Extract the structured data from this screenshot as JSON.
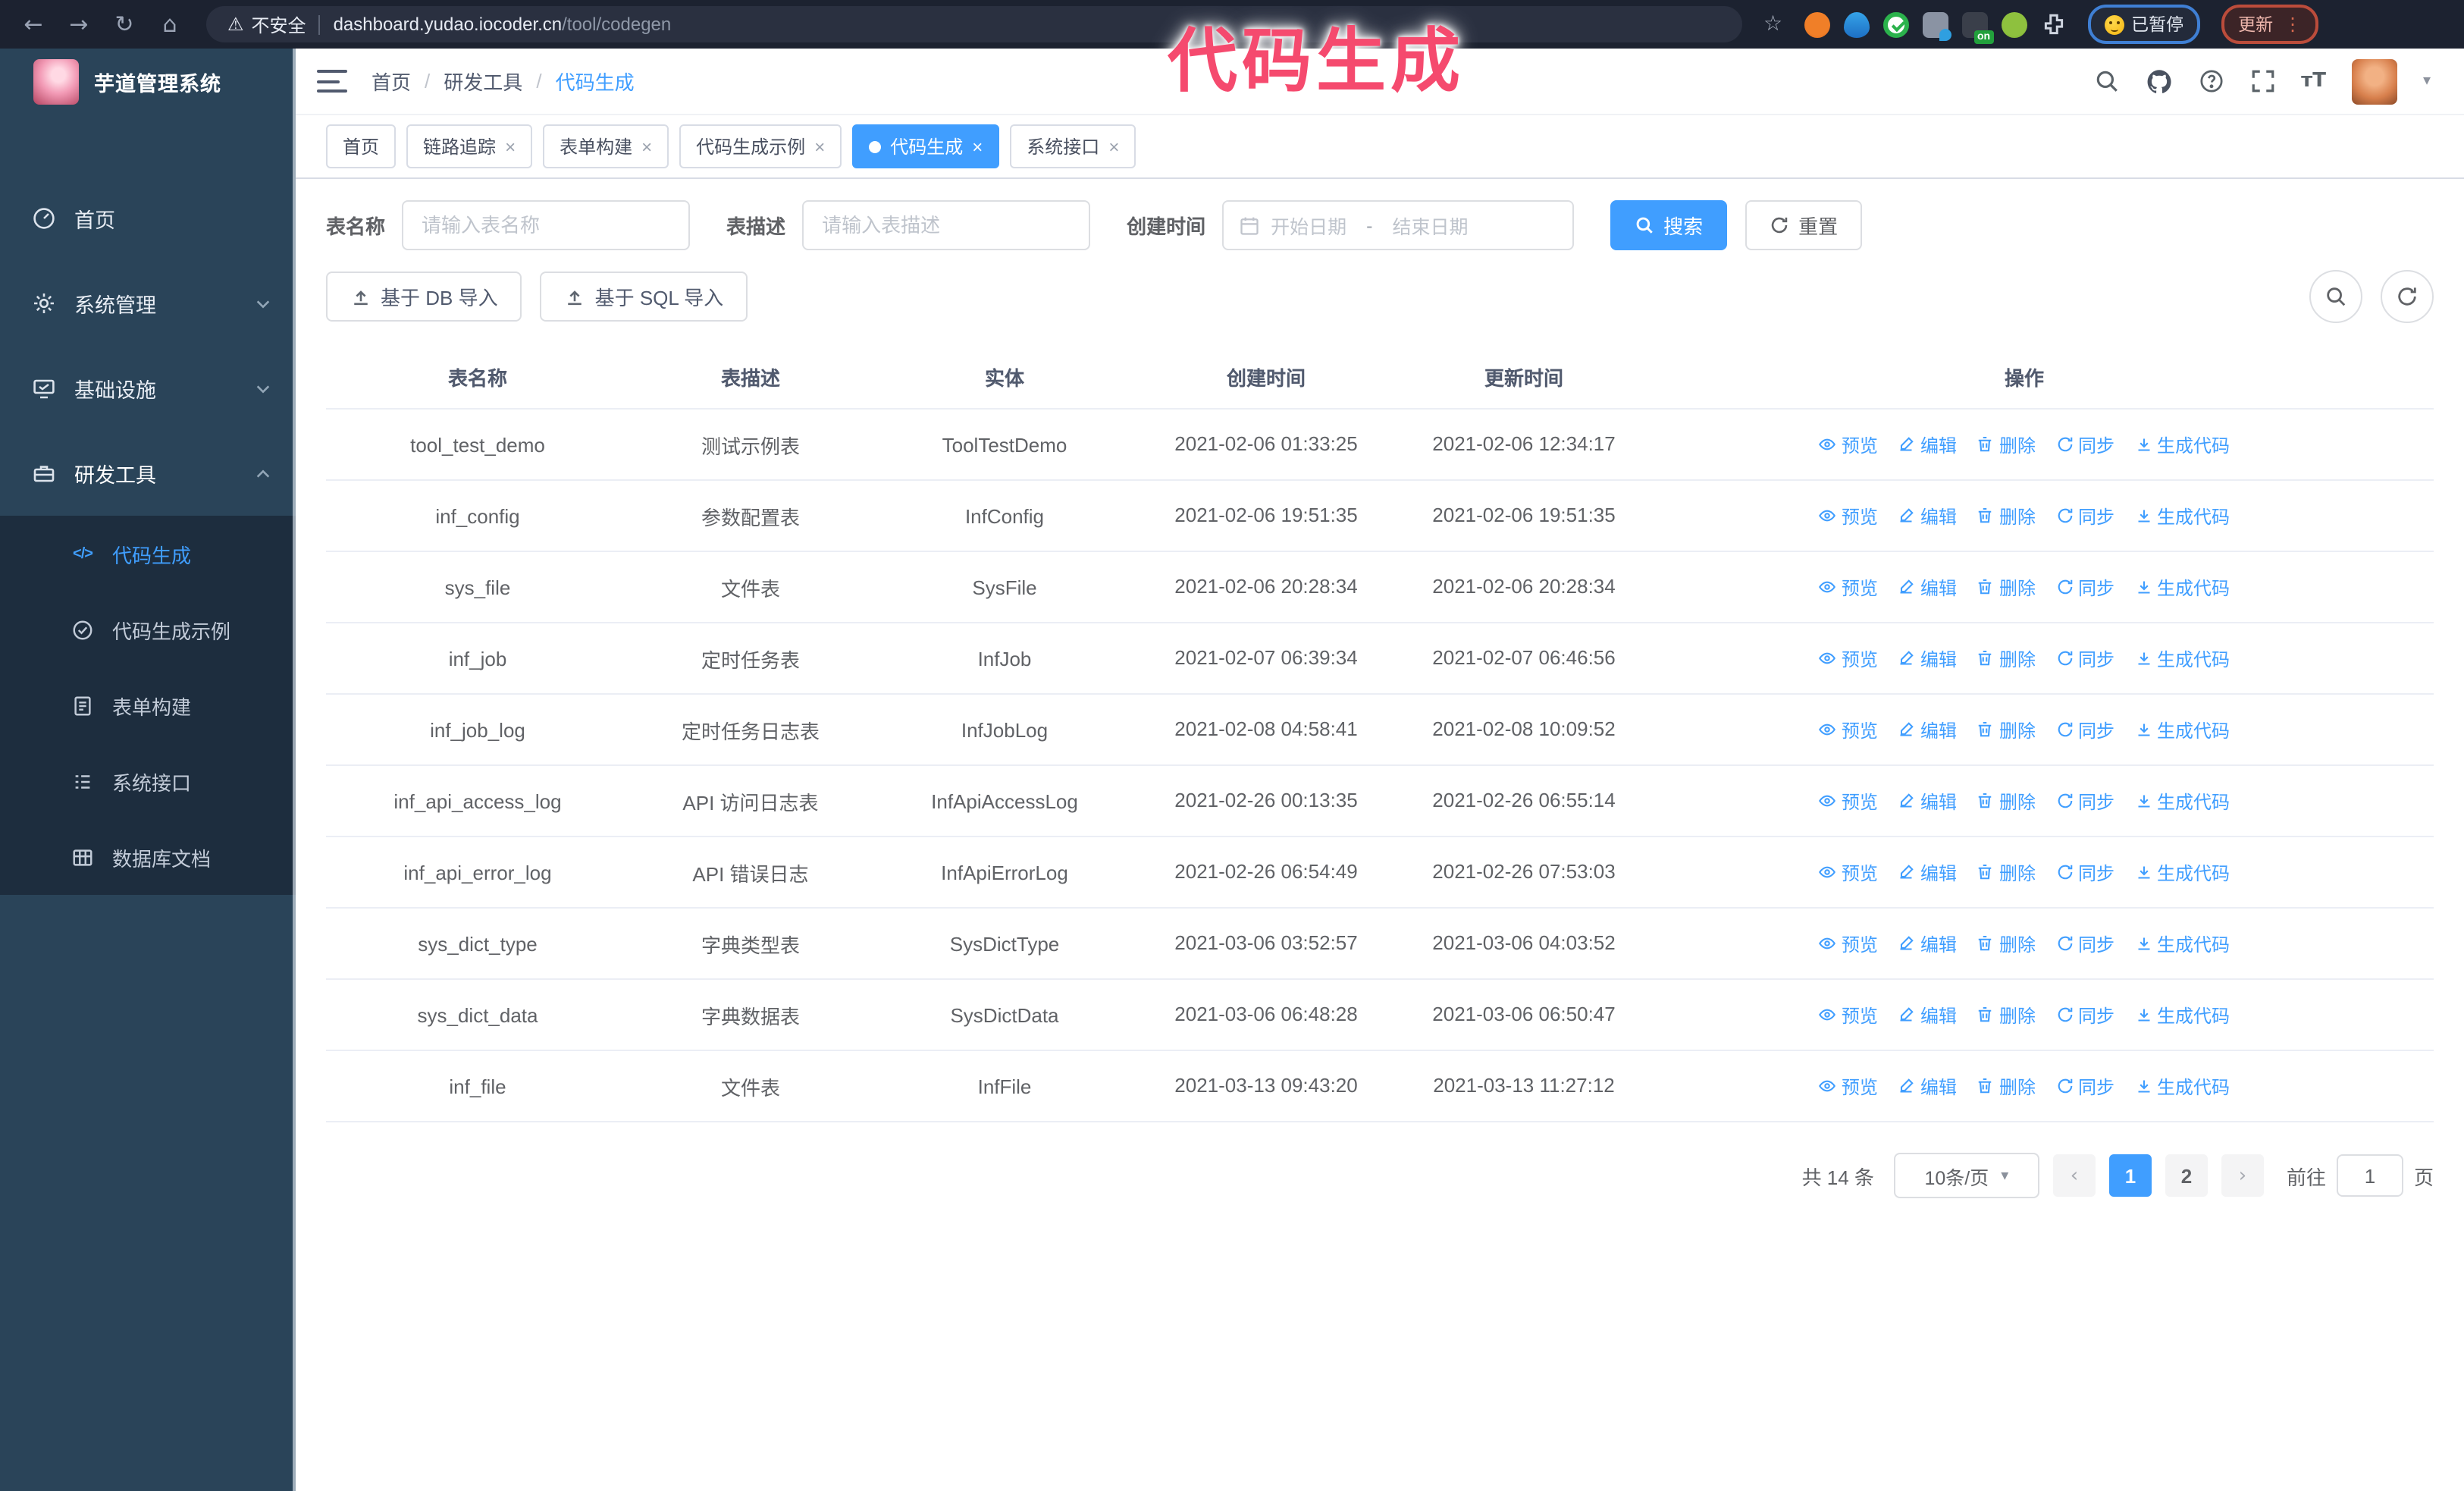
{
  "browser": {
    "security_label": "不安全",
    "url_host": "dashboard.yudao.iocoder.cn",
    "url_path": "/tool/codegen",
    "paused_button": "已暂停",
    "update_button": "更新",
    "extension_badge": "on"
  },
  "watermark": "代码生成",
  "sidebar": {
    "title": "芋道管理系统",
    "menu": [
      {
        "label": "首页"
      },
      {
        "label": "系统管理"
      },
      {
        "label": "基础设施"
      },
      {
        "label": "研发工具"
      }
    ],
    "submenu": [
      {
        "label": "代码生成"
      },
      {
        "label": "代码生成示例"
      },
      {
        "label": "表单构建"
      },
      {
        "label": "系统接口"
      },
      {
        "label": "数据库文档"
      }
    ]
  },
  "header": {
    "breadcrumb": [
      "首页",
      "研发工具",
      "代码生成"
    ]
  },
  "tabs": [
    {
      "label": "首页"
    },
    {
      "label": "链路追踪"
    },
    {
      "label": "表单构建"
    },
    {
      "label": "代码生成示例"
    },
    {
      "label": "代码生成"
    },
    {
      "label": "系统接口"
    }
  ],
  "filters": {
    "table_name_label": "表名称",
    "table_name_placeholder": "请输入表名称",
    "table_desc_label": "表描述",
    "table_desc_placeholder": "请输入表描述",
    "create_time_label": "创建时间",
    "date_start_placeholder": "开始日期",
    "date_separator": "-",
    "date_end_placeholder": "结束日期",
    "search_button": "搜索",
    "reset_button": "重置"
  },
  "toolbar": {
    "import_db": "基于 DB 导入",
    "import_sql": "基于 SQL 导入"
  },
  "table": {
    "columns": [
      "表名称",
      "表描述",
      "实体",
      "创建时间",
      "更新时间",
      "操作"
    ],
    "actions": [
      "预览",
      "编辑",
      "删除",
      "同步",
      "生成代码"
    ],
    "rows": [
      {
        "name": "tool_test_demo",
        "desc": "测试示例表",
        "entity": "ToolTestDemo",
        "created": "2021-02-06 01:33:25",
        "updated": "2021-02-06 12:34:17"
      },
      {
        "name": "inf_config",
        "desc": "参数配置表",
        "entity": "InfConfig",
        "created": "2021-02-06 19:51:35",
        "updated": "2021-02-06 19:51:35"
      },
      {
        "name": "sys_file",
        "desc": "文件表",
        "entity": "SysFile",
        "created": "2021-02-06 20:28:34",
        "updated": "2021-02-06 20:28:34"
      },
      {
        "name": "inf_job",
        "desc": "定时任务表",
        "entity": "InfJob",
        "created": "2021-02-07 06:39:34",
        "updated": "2021-02-07 06:46:56"
      },
      {
        "name": "inf_job_log",
        "desc": "定时任务日志表",
        "entity": "InfJobLog",
        "created": "2021-02-08 04:58:41",
        "updated": "2021-02-08 10:09:52"
      },
      {
        "name": "inf_api_access_log",
        "desc": "API 访问日志表",
        "entity": "InfApiAccessLog",
        "created": "2021-02-26 00:13:35",
        "updated": "2021-02-26 06:55:14"
      },
      {
        "name": "inf_api_error_log",
        "desc": "API 错误日志",
        "entity": "InfApiErrorLog",
        "created": "2021-02-26 06:54:49",
        "updated": "2021-02-26 07:53:03"
      },
      {
        "name": "sys_dict_type",
        "desc": "字典类型表",
        "entity": "SysDictType",
        "created": "2021-03-06 03:52:57",
        "updated": "2021-03-06 04:03:52"
      },
      {
        "name": "sys_dict_data",
        "desc": "字典数据表",
        "entity": "SysDictData",
        "created": "2021-03-06 06:48:28",
        "updated": "2021-03-06 06:50:47"
      },
      {
        "name": "inf_file",
        "desc": "文件表",
        "entity": "InfFile",
        "created": "2021-03-13 09:43:20",
        "updated": "2021-03-13 11:27:12"
      }
    ]
  },
  "pagination": {
    "total": "共 14 条",
    "page_size": "10条/页",
    "pages": [
      "1",
      "2"
    ],
    "goto_label": "前往",
    "goto_value": "1",
    "goto_suffix": "页"
  },
  "icons": {
    "back": "←",
    "forward": "→",
    "reload": "↻",
    "home": "⌂",
    "warning": "⚠",
    "star": "☆",
    "close": "×",
    "breadcrumb_separator": "/",
    "caret_down": "▾",
    "pager_prev": "‹",
    "pager_next": "›",
    "kebab": "⋮",
    "font_size": "тT",
    "code": "</>"
  },
  "colors": {
    "accent_blue": "#409eff",
    "watermark_pink": "#f54a6e",
    "sidebar_bg": "#2a4459",
    "submenu_bg": "#1d2d3e",
    "browser_bar_bg": "#1c2230",
    "border": "#ebeef5",
    "update_button_red": "#bb4c3b",
    "paused_button_blue": "#3f7fd4"
  }
}
